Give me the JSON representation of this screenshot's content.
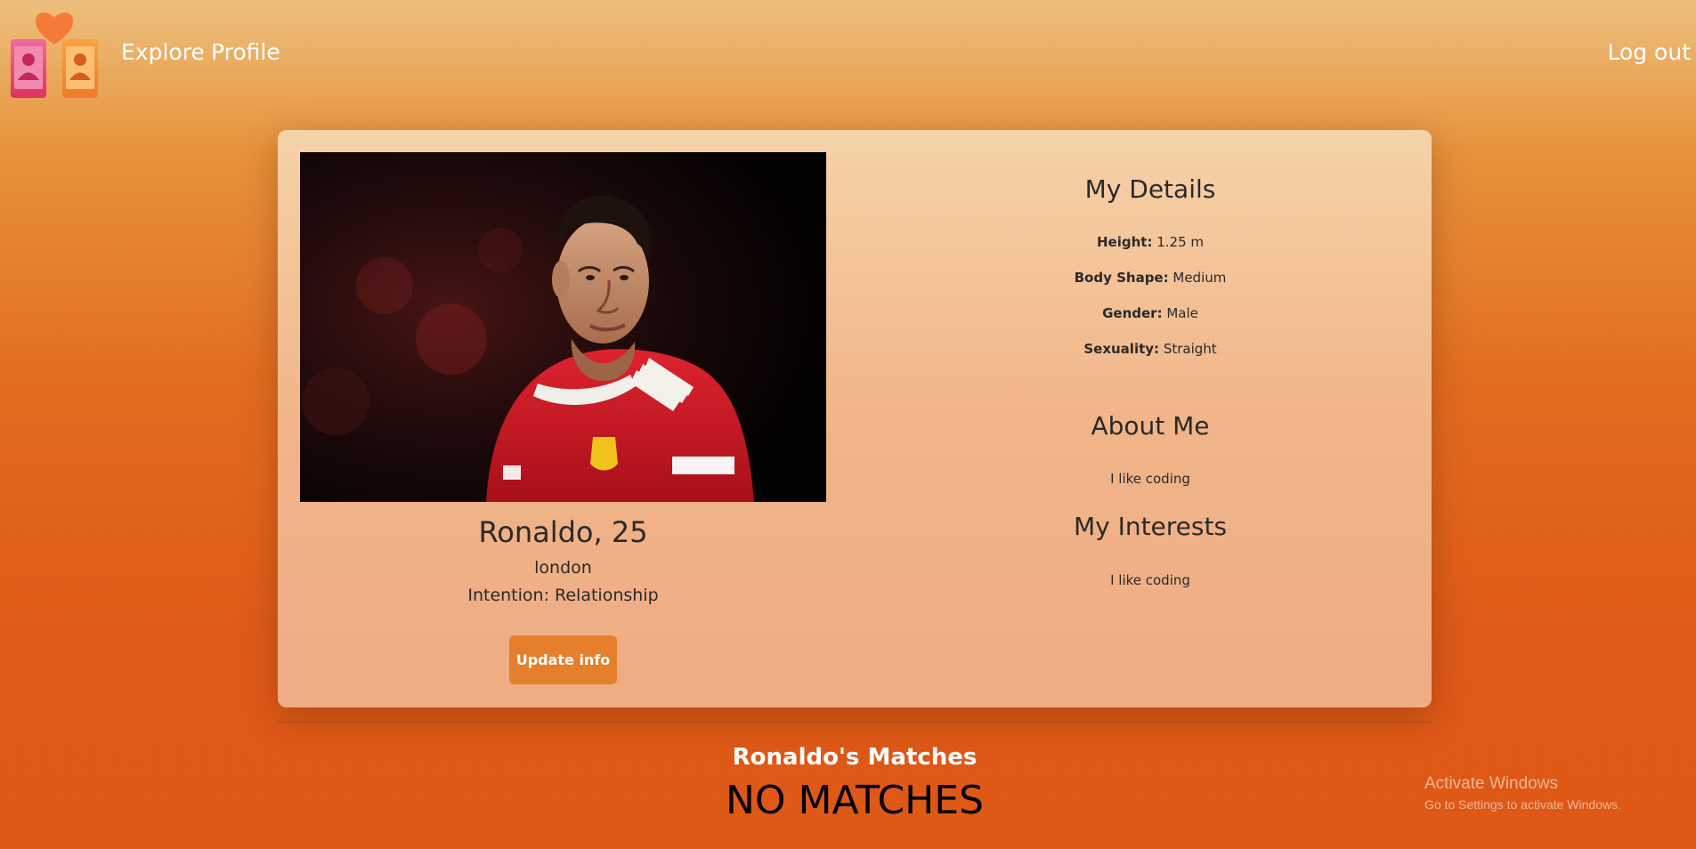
{
  "nav": {
    "explore_label": "Explore",
    "profile_label": "Profile",
    "logout_label": "Log out"
  },
  "profile": {
    "name_age": "Ronaldo, 25",
    "city": "london",
    "intention": "Intention: Relationship",
    "update_button_label": "Update info",
    "photo_alt": "Profile photo"
  },
  "details": {
    "title": "My Details",
    "height_label": "Height:",
    "height_value": "1.25 m",
    "body_shape_label": "Body Shape:",
    "body_shape_value": "Medium",
    "gender_label": "Gender:",
    "gender_value": "Male",
    "sexuality_label": "Sexuality:",
    "sexuality_value": "Straight"
  },
  "about": {
    "title": "About Me",
    "text": "I like coding"
  },
  "interests": {
    "title": "My Interests",
    "text": "I like coding"
  },
  "matches": {
    "title": "Ronaldo's Matches",
    "empty_text": "NO MATCHES"
  },
  "watermark": {
    "line1": "Activate Windows",
    "line2": "Go to Settings to activate Windows."
  },
  "colors": {
    "button": "#e57f2c",
    "heart": "#f07b37",
    "phone_left": "#e84a7a",
    "phone_right": "#f4892f"
  }
}
